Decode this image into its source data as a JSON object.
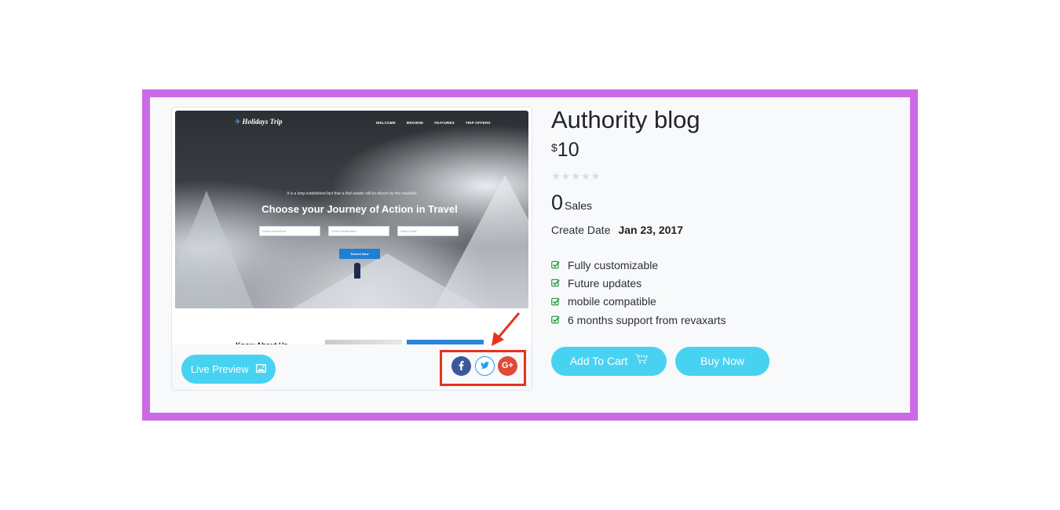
{
  "product": {
    "title": "Authority blog",
    "currency": "$",
    "price": "10",
    "rating": 0,
    "rating_max": 5,
    "sales_count": "0",
    "sales_label": "Sales",
    "create_date_label": "Create Date",
    "create_date": "Jan 23, 2017",
    "features": [
      "Fully customizable",
      "Future updates",
      "mobile compatible",
      "6 months support from revaxarts"
    ],
    "add_to_cart_label": "Add To Cart",
    "buy_now_label": "Buy Now"
  },
  "preview": {
    "live_preview_label": "Live Preview",
    "thumbnail": {
      "logo": "Holidays Trip",
      "nav": [
        "WELCOME",
        "BROWSE",
        "FEATURES",
        "TRIP OFFERS"
      ],
      "tagline": "It is a long established fact that a that reader will be discon by the readable",
      "headline": "Choose your Journey of Action in Travel",
      "fields": [
        "Select Adventure",
        "Select Destination",
        "Select Date"
      ],
      "search_button": "Search Now",
      "section_heading": "Know About Us"
    },
    "share": [
      "facebook-icon",
      "twitter-icon",
      "google-plus-icon"
    ]
  },
  "colors": {
    "frame": "#cb6ae6",
    "accent": "#48d2f2",
    "highlight": "#e8321e",
    "check": "#2e9e44",
    "facebook": "#3b5998",
    "twitter": "#1da1f2",
    "google_plus": "#dd4b39"
  }
}
